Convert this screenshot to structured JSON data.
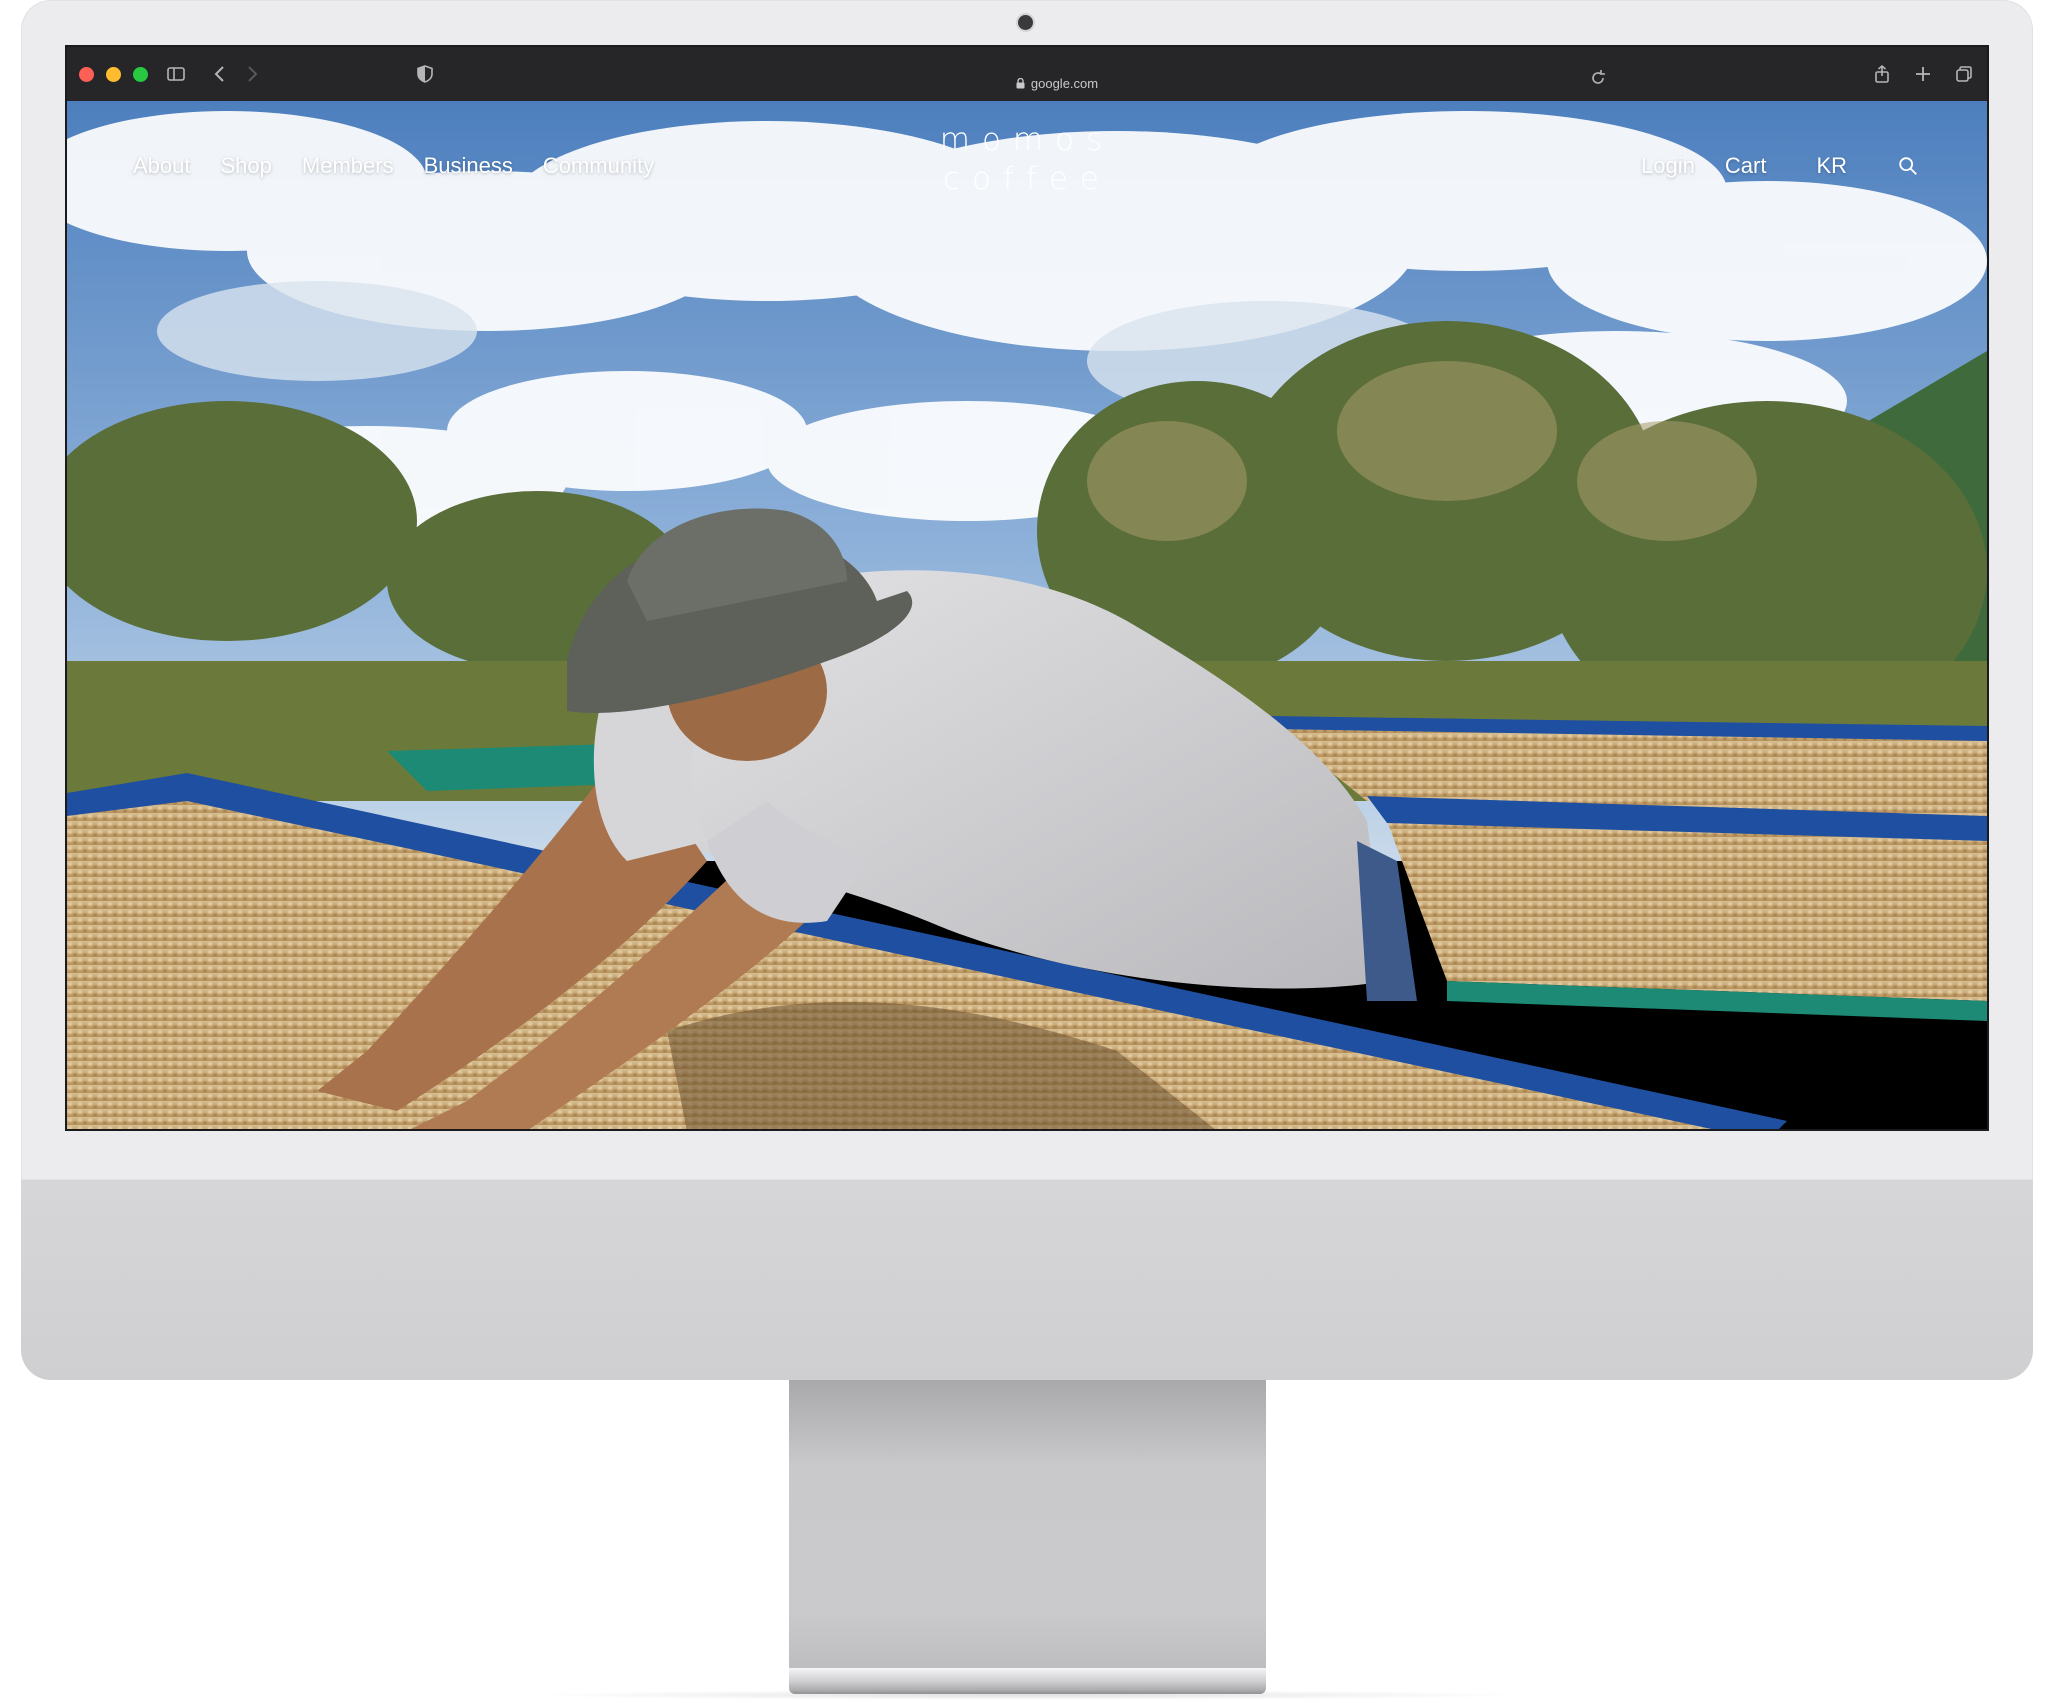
{
  "browser": {
    "url": "google.com"
  },
  "site": {
    "logo_line1": "momos",
    "logo_line2": "coffee",
    "nav_left": [
      "About",
      "Shop",
      "Members",
      "Business",
      "Community"
    ],
    "nav_right": {
      "login": "Login",
      "cart": "Cart",
      "language": "KR"
    }
  },
  "colors": {
    "toolbar": "#262628",
    "nav_text": "#ffffff",
    "sky": "#5f8fc8",
    "beans": "#c9a673",
    "net_blue": "#1f4fa0",
    "net_green": "#1c8a74"
  },
  "hero": {
    "icon_search": "search-icon"
  }
}
